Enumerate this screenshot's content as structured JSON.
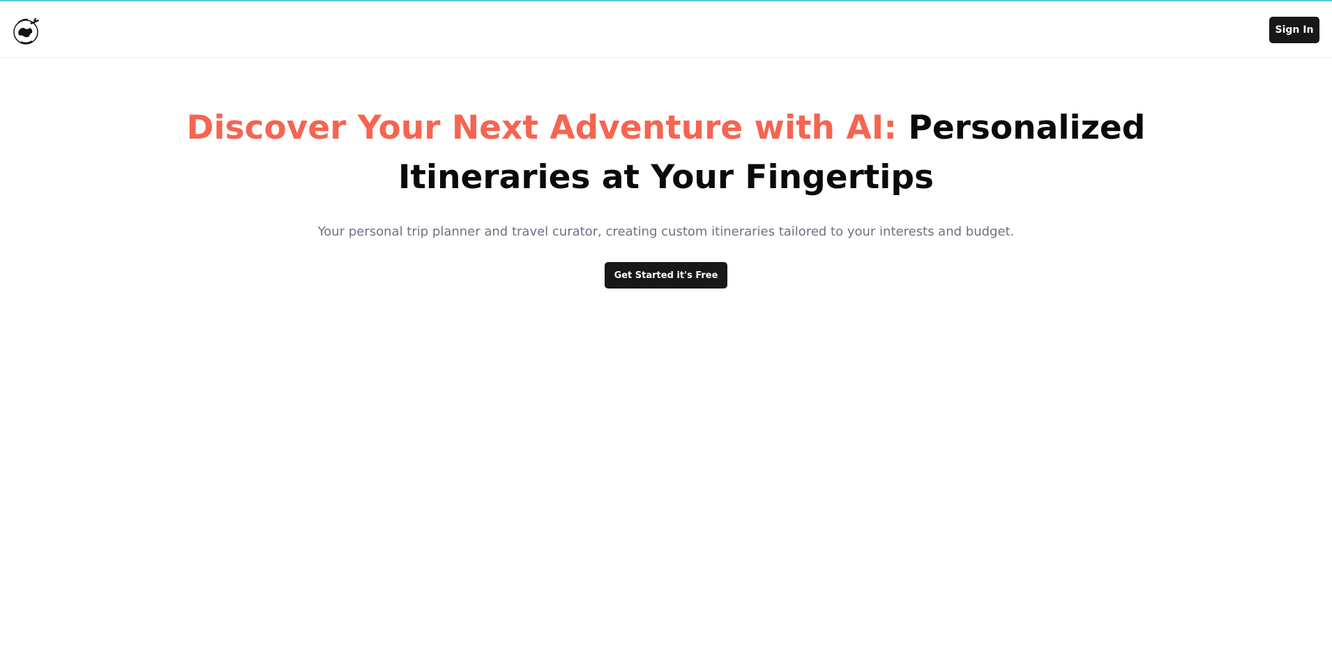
{
  "header": {
    "logo_icon": "trip-next-globe-airplane-logo",
    "sign_in_label": "Sign In"
  },
  "hero": {
    "headline_accent": "Discover Your Next Adventure with AI:",
    "headline_rest": "Personalized Itineraries at Your Fingertips",
    "subtitle": "Your personal trip planner and travel curator, creating custom itineraries tailored to your interests and budget.",
    "cta_label": "Get Started it's Free"
  },
  "colors": {
    "accent": "#f56551",
    "button_bg": "#18181b",
    "top_bar": "#5bc8e0",
    "subtitle_text": "#6b7280"
  }
}
